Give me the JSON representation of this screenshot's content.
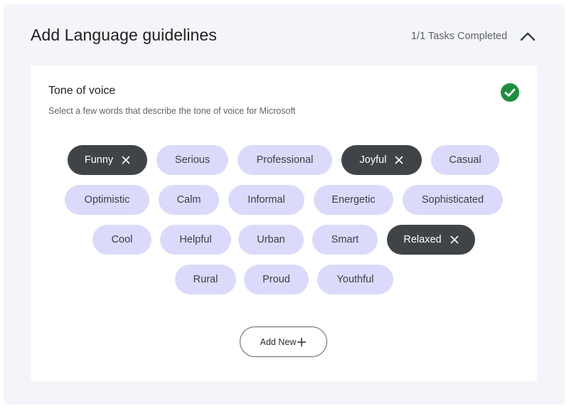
{
  "header": {
    "title": "Add Language guidelines",
    "status": "1/1 Tasks Completed",
    "collapse_icon": "chevron-up-icon"
  },
  "section": {
    "title": "Tone of voice",
    "subtitle": "Select a few words that describe the tone of voice for Microsoft",
    "status_icon": "check-circle-icon",
    "status_color": "#1e8e3e"
  },
  "chips": [
    {
      "label": "Funny",
      "selected": true
    },
    {
      "label": "Serious",
      "selected": false
    },
    {
      "label": "Professional",
      "selected": false
    },
    {
      "label": "Joyful",
      "selected": true
    },
    {
      "label": "Casual",
      "selected": false
    },
    {
      "label": "Optimistic",
      "selected": false
    },
    {
      "label": "Calm",
      "selected": false
    },
    {
      "label": "Informal",
      "selected": false
    },
    {
      "label": "Energetic",
      "selected": false
    },
    {
      "label": "Sophisticated",
      "selected": false
    },
    {
      "label": "Cool",
      "selected": false
    },
    {
      "label": "Helpful",
      "selected": false
    },
    {
      "label": "Urban",
      "selected": false
    },
    {
      "label": "Smart",
      "selected": false
    },
    {
      "label": "Relaxed",
      "selected": true
    },
    {
      "label": "Rural",
      "selected": false
    },
    {
      "label": "Proud",
      "selected": false
    },
    {
      "label": "Youthful",
      "selected": false
    }
  ],
  "add_button": {
    "label": "Add New",
    "icon": "plus-icon"
  },
  "colors": {
    "chip_default": "#dcdafb",
    "chip_selected": "#404448",
    "panel_background": "#f4f5fa"
  }
}
